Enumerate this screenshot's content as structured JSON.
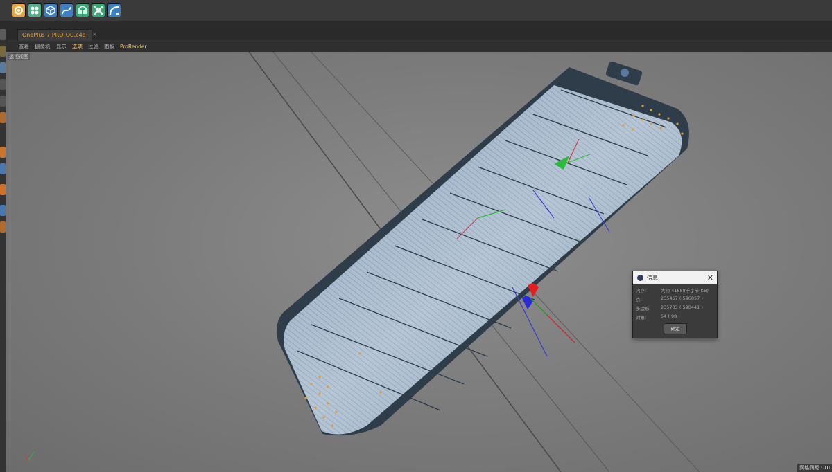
{
  "toolbar": {
    "buttons": [
      {
        "icon": "gear-icon",
        "color": "#e9a43b"
      },
      {
        "icon": "cloner-icon",
        "color": "#4fb18a"
      },
      {
        "icon": "cube-icon",
        "color": "#3c7fc3"
      },
      {
        "icon": "spline-pen-icon",
        "color": "#3c7fc3"
      },
      {
        "icon": "subdivision-icon",
        "color": "#35a976"
      },
      {
        "icon": "deformer-icon",
        "color": "#35a976"
      },
      {
        "icon": "bend-icon",
        "color": "#3c7fc3"
      }
    ]
  },
  "document": {
    "tab_title": "OnePlus 7 PRO-OC.c4d",
    "tab_close": "×"
  },
  "menubar": {
    "items": [
      "查看",
      "摄像机",
      "显示",
      "选项",
      "过滤",
      "面板",
      "ProRender"
    ]
  },
  "viewport": {
    "label": "透视视图",
    "status": "网格间距 : 10"
  },
  "info_dialog": {
    "title": "信息",
    "close": "✕",
    "rows": [
      {
        "key": "内存:",
        "value": "大约 41688千字节(KB)"
      },
      {
        "key": "点:",
        "value": "235467 ( 596857 )"
      },
      {
        "key": "多边形:",
        "value": "235733 ( 590441 )"
      },
      {
        "key": "对象:",
        "value": "54 ( 98 )"
      }
    ],
    "ok_label": "确定"
  },
  "colors": {
    "accent": "#e8a13a",
    "panel": "#3a3a3a",
    "viewport_bg": "#7d7d7d"
  }
}
